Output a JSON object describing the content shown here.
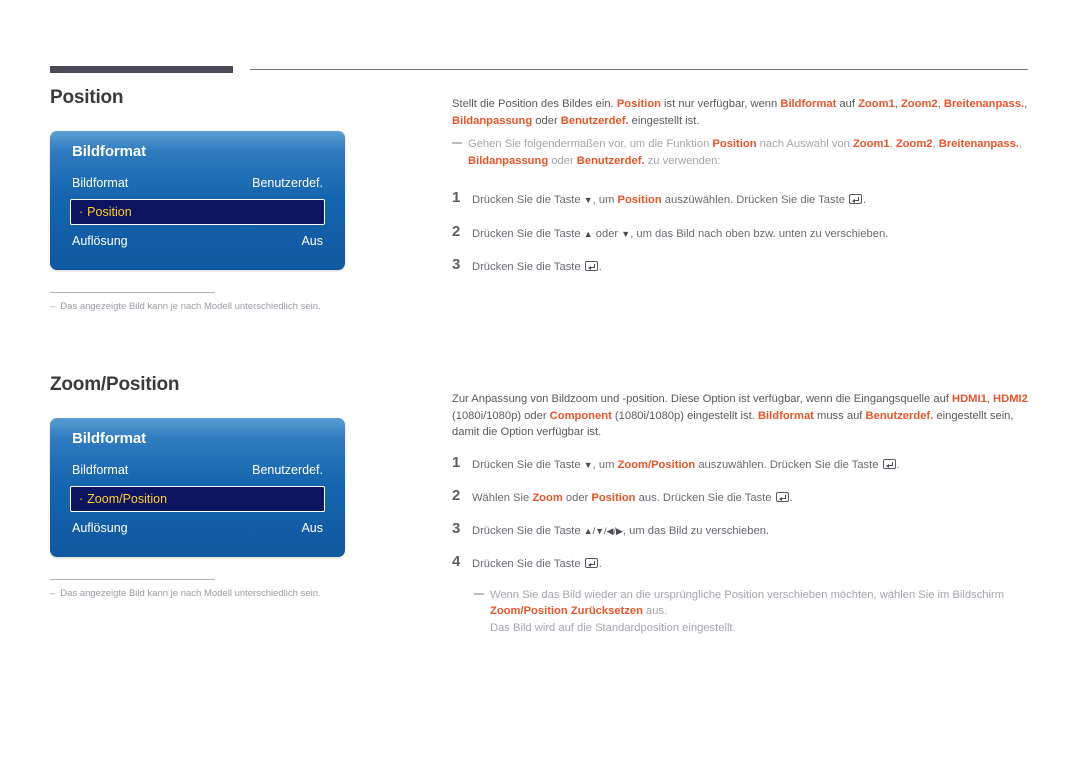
{
  "page": {
    "rule_top": true
  },
  "sections": [
    {
      "id": "position",
      "title": "Position",
      "osd": {
        "title": "Bildformat",
        "rows": [
          {
            "label": "Bildformat",
            "value": "Benutzerdef."
          },
          {
            "label": "Position",
            "value": "",
            "selected": true,
            "bullet": "·"
          },
          {
            "label": "Auflösung",
            "value": "Aus"
          }
        ]
      },
      "footnote": {
        "dash": "–",
        "text": "Das angezeigte Bild kann je nach Modell unterschiedlich sein."
      },
      "intro": {
        "part1": "Stellt die Position des Bildes ein. ",
        "hl1": "Position",
        "part2": " ist nur verfügbar, wenn ",
        "hl2": "Bildformat",
        "part3": " auf ",
        "hl3": "Zoom1",
        "part4": ", ",
        "hl4": "Zoom2",
        "part5": ", ",
        "hl5": "Breitenanpass.",
        "part6": ", ",
        "hl6": "Bildanpassung",
        "part7": " oder ",
        "hl7": "Benutzerdef.",
        "part8": " eingestellt ist."
      },
      "note": {
        "part1": "Gehen Sie folgendermaßen vor, um die Funktion ",
        "hl1": "Position",
        "part2": " nach Auswahl von ",
        "hl2": "Zoom1",
        "part3": ", ",
        "hl3": "Zoom2",
        "part4": ", ",
        "hl4": "Breitenanpass.",
        "part5": ", ",
        "hl5": "Bildanpassung",
        "part6": " oder ",
        "hl6": "Benutzerdef.",
        "part7": " zu verwenden:"
      },
      "steps": [
        {
          "num": "1",
          "pre": "Drücken Sie die Taste ",
          "arrow1": "▼",
          "mid1": ", um ",
          "hl1": "Position",
          "mid2": " auszüwählen. Drücken Sie die Taste ",
          "post": "."
        },
        {
          "num": "2",
          "pre": "Drücken Sie die Taste ",
          "arrow1": "▲",
          "mid1": " oder ",
          "arrow2": "▼",
          "mid2": ", um das Bild nach oben bzw. unten zu verschieben.",
          "post": ""
        },
        {
          "num": "3",
          "pre": "Drücken Sie die Taste ",
          "post": "."
        }
      ]
    },
    {
      "id": "zoom-position",
      "title": "Zoom/Position",
      "osd": {
        "title": "Bildformat",
        "rows": [
          {
            "label": "Bildformat",
            "value": "Benutzerdef."
          },
          {
            "label": "Zoom/Position",
            "value": "",
            "selected": true,
            "bullet": "·"
          },
          {
            "label": "Auflösung",
            "value": "Aus"
          }
        ]
      },
      "footnote": {
        "dash": "–",
        "text": "Das angezeigte Bild kann je nach Modell unterschiedlich sein."
      },
      "intro": {
        "part1": "Zur Anpassung von Bildzoom und -position. Diese Option ist verfügbar, wenn die Eingangsquelle auf ",
        "hl1": "HDMI1",
        "part2": ", ",
        "hl2": "HDMI2",
        "part3": " (1080i/1080p) oder ",
        "hl3": "Component",
        "part4": " (1080i/1080p) eingestellt ist. ",
        "hl4": "Bildformat",
        "part5": " muss auf ",
        "hl5": "Benutzerdef.",
        "part6": " eingestellt sein, damit die Option verfügbar ist."
      },
      "steps": [
        {
          "num": "1",
          "pre": "Drücken Sie die Taste ",
          "arrow1": "▼",
          "mid1": ", um ",
          "hl1": "Zoom/Position",
          "mid2": " auszuwählen. Drücken Sie die Taste ",
          "post": "."
        },
        {
          "num": "2",
          "pre": "Wählen Sie ",
          "hl1": "Zoom",
          "mid1": " oder ",
          "hl2": "Position",
          "mid2": " aus. Drücken Sie die Taste ",
          "post": "."
        },
        {
          "num": "3",
          "pre": "Drücken Sie die Taste ",
          "arrows": "▲/▼/◀/▶",
          "mid1": ", um das Bild zu verschieben.",
          "post": ""
        },
        {
          "num": "4",
          "pre": "Drücken Sie die Taste ",
          "post": "."
        }
      ],
      "tail_note": {
        "part1": "Wenn Sie das Bild wieder an die ursprüngliche Position verschieben möchten, wählen Sie im Bildschirm ",
        "hl1": "Zoom/",
        "hl2": "Position Zurücksetzen",
        "part2": " aus.",
        "sub": "Das Bild wird auf die Standardposition eingestellt."
      }
    }
  ],
  "colors": {
    "accent_orange": "#e8552a",
    "osd_blue_top": "#5a9fd4",
    "osd_blue_bottom": "#1059a0",
    "osd_highlight_bg": "#0c1460",
    "osd_highlight_text": "#ffcc33",
    "rule_dark": "#4b4b57",
    "body_text": "#5a5a5a",
    "muted_text": "#a5a5ad"
  }
}
